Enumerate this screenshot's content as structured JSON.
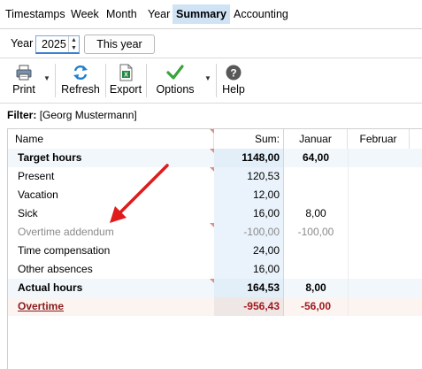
{
  "tabs": [
    "Timestamps",
    "Week",
    "Month",
    "Year",
    "Summary",
    "Accounting"
  ],
  "active_tab": "Summary",
  "year_row": {
    "label": "Year",
    "value": "2025",
    "this_year_button": "This year"
  },
  "toolbar": {
    "print": "Print",
    "refresh": "Refresh",
    "export": "Export",
    "options": "Options",
    "help": "Help"
  },
  "filter": {
    "label": "Filter:",
    "value": "[Georg Mustermann]"
  },
  "grid": {
    "columns": [
      "Name",
      "Sum:",
      "Januar",
      "Februar"
    ],
    "rows": [
      {
        "name": "Target hours",
        "sum": "1148,00",
        "jan": "64,00",
        "feb": "",
        "style": "bold-hl"
      },
      {
        "name": "Present",
        "sum": "120,53",
        "jan": "",
        "feb": "",
        "style": "normal"
      },
      {
        "name": "Vacation",
        "sum": "12,00",
        "jan": "",
        "feb": "",
        "style": "normal"
      },
      {
        "name": "Sick",
        "sum": "16,00",
        "jan": "8,00",
        "feb": "",
        "style": "normal"
      },
      {
        "name": "Overtime addendum",
        "sum": "-100,00",
        "jan": "-100,00",
        "feb": "",
        "style": "gray"
      },
      {
        "name": "Time compensation",
        "sum": "24,00",
        "jan": "",
        "feb": "",
        "style": "normal"
      },
      {
        "name": "Other absences",
        "sum": "16,00",
        "jan": "",
        "feb": "",
        "style": "normal"
      },
      {
        "name": "Actual hours",
        "sum": "164,53",
        "jan": "8,00",
        "feb": "",
        "style": "bold-hl"
      },
      {
        "name": "Overtime",
        "sum": "-956,43",
        "jan": "-56,00",
        "feb": "",
        "style": "overtime"
      }
    ]
  },
  "colors": {
    "active_tab_bg": "#cfe3f5",
    "sum_column_bg": "#eaf3fb",
    "overtime_text": "#a1191f",
    "annotation_arrow": "#e01b1b"
  },
  "icons": {
    "print": "printer-icon",
    "refresh": "refresh-icon",
    "export": "excel-export-icon",
    "options": "checkmark-icon",
    "help": "help-icon"
  }
}
